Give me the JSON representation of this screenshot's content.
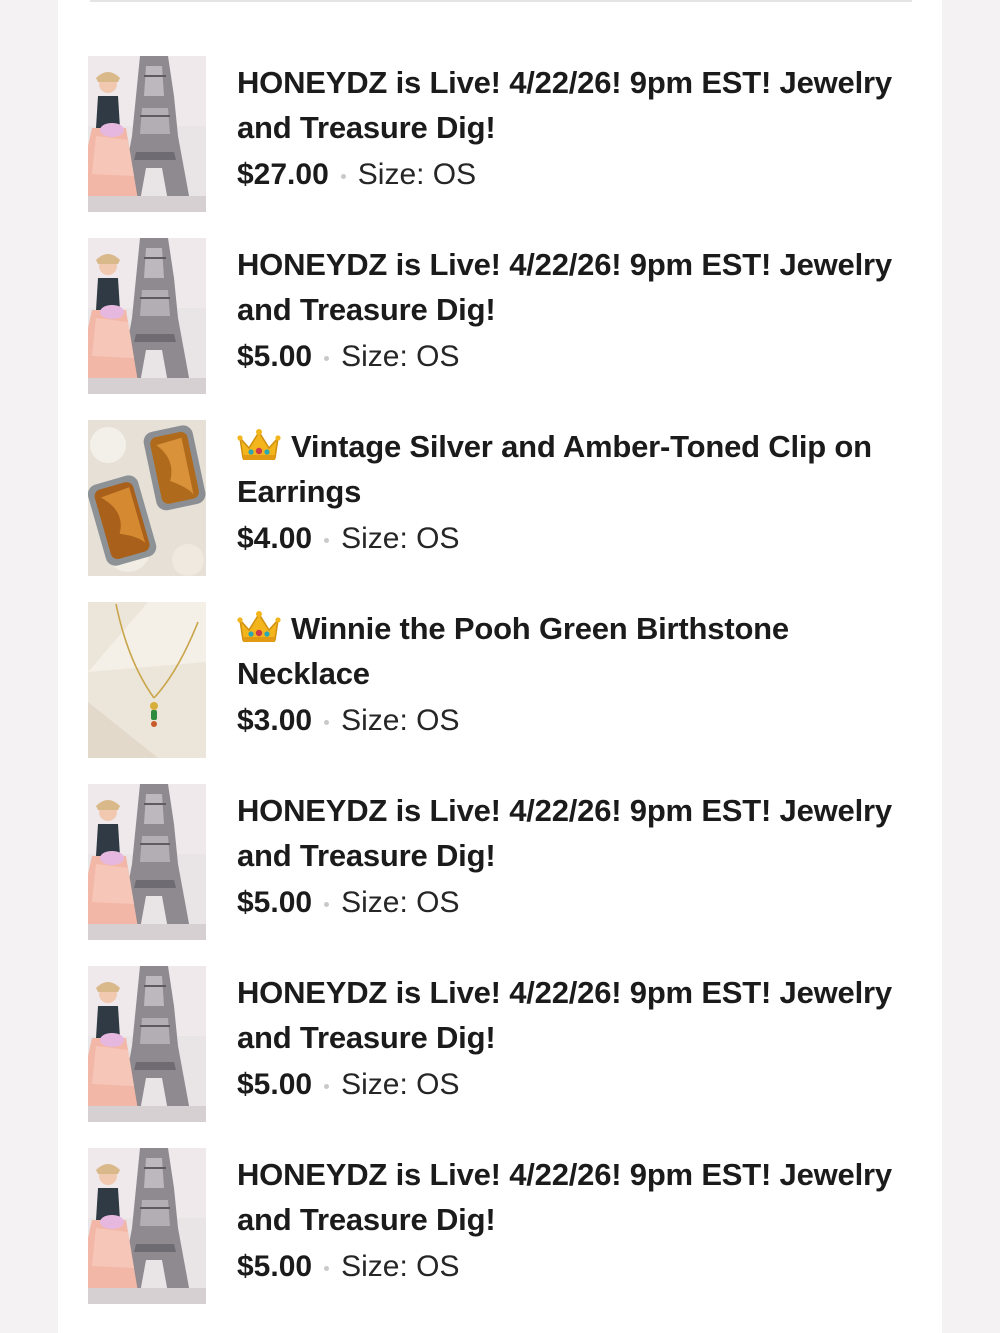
{
  "listings": [
    {
      "title": "HONEYDZ is Live! 4/22/26! 9pm EST! Jewelry and Treasure Dig!",
      "price": "$27.00",
      "size": "Size: OS",
      "image": "eiffel-tower-photo",
      "badge": null
    },
    {
      "title": "HONEYDZ is Live! 4/22/26! 9pm EST! Jewelry and Treasure Dig!",
      "price": "$5.00",
      "size": "Size: OS",
      "image": "eiffel-tower-photo",
      "badge": null
    },
    {
      "title": "Vintage Silver and Amber-Toned Clip on Earrings",
      "price": "$4.00",
      "size": "Size: OS",
      "image": "amber-earrings-photo",
      "badge": "crown-icon"
    },
    {
      "title": "Winnie the Pooh Green Birthstone Necklace",
      "price": "$3.00",
      "size": "Size: OS",
      "image": "necklace-photo",
      "badge": "crown-icon"
    },
    {
      "title": "HONEYDZ is Live! 4/22/26! 9pm EST! Jewelry and Treasure Dig!",
      "price": "$5.00",
      "size": "Size: OS",
      "image": "eiffel-tower-photo",
      "badge": null
    },
    {
      "title": "HONEYDZ is Live! 4/22/26! 9pm EST! Jewelry and Treasure Dig!",
      "price": "$5.00",
      "size": "Size: OS",
      "image": "eiffel-tower-photo",
      "badge": null
    },
    {
      "title": "HONEYDZ is Live! 4/22/26! 9pm EST! Jewelry and Treasure Dig!",
      "price": "$5.00",
      "size": "Size: OS",
      "image": "eiffel-tower-photo",
      "badge": null
    }
  ],
  "colors": {
    "text": "#1b1b1b",
    "separator_dot": "#c9c9c9",
    "page_background": "#f4f2f2"
  }
}
